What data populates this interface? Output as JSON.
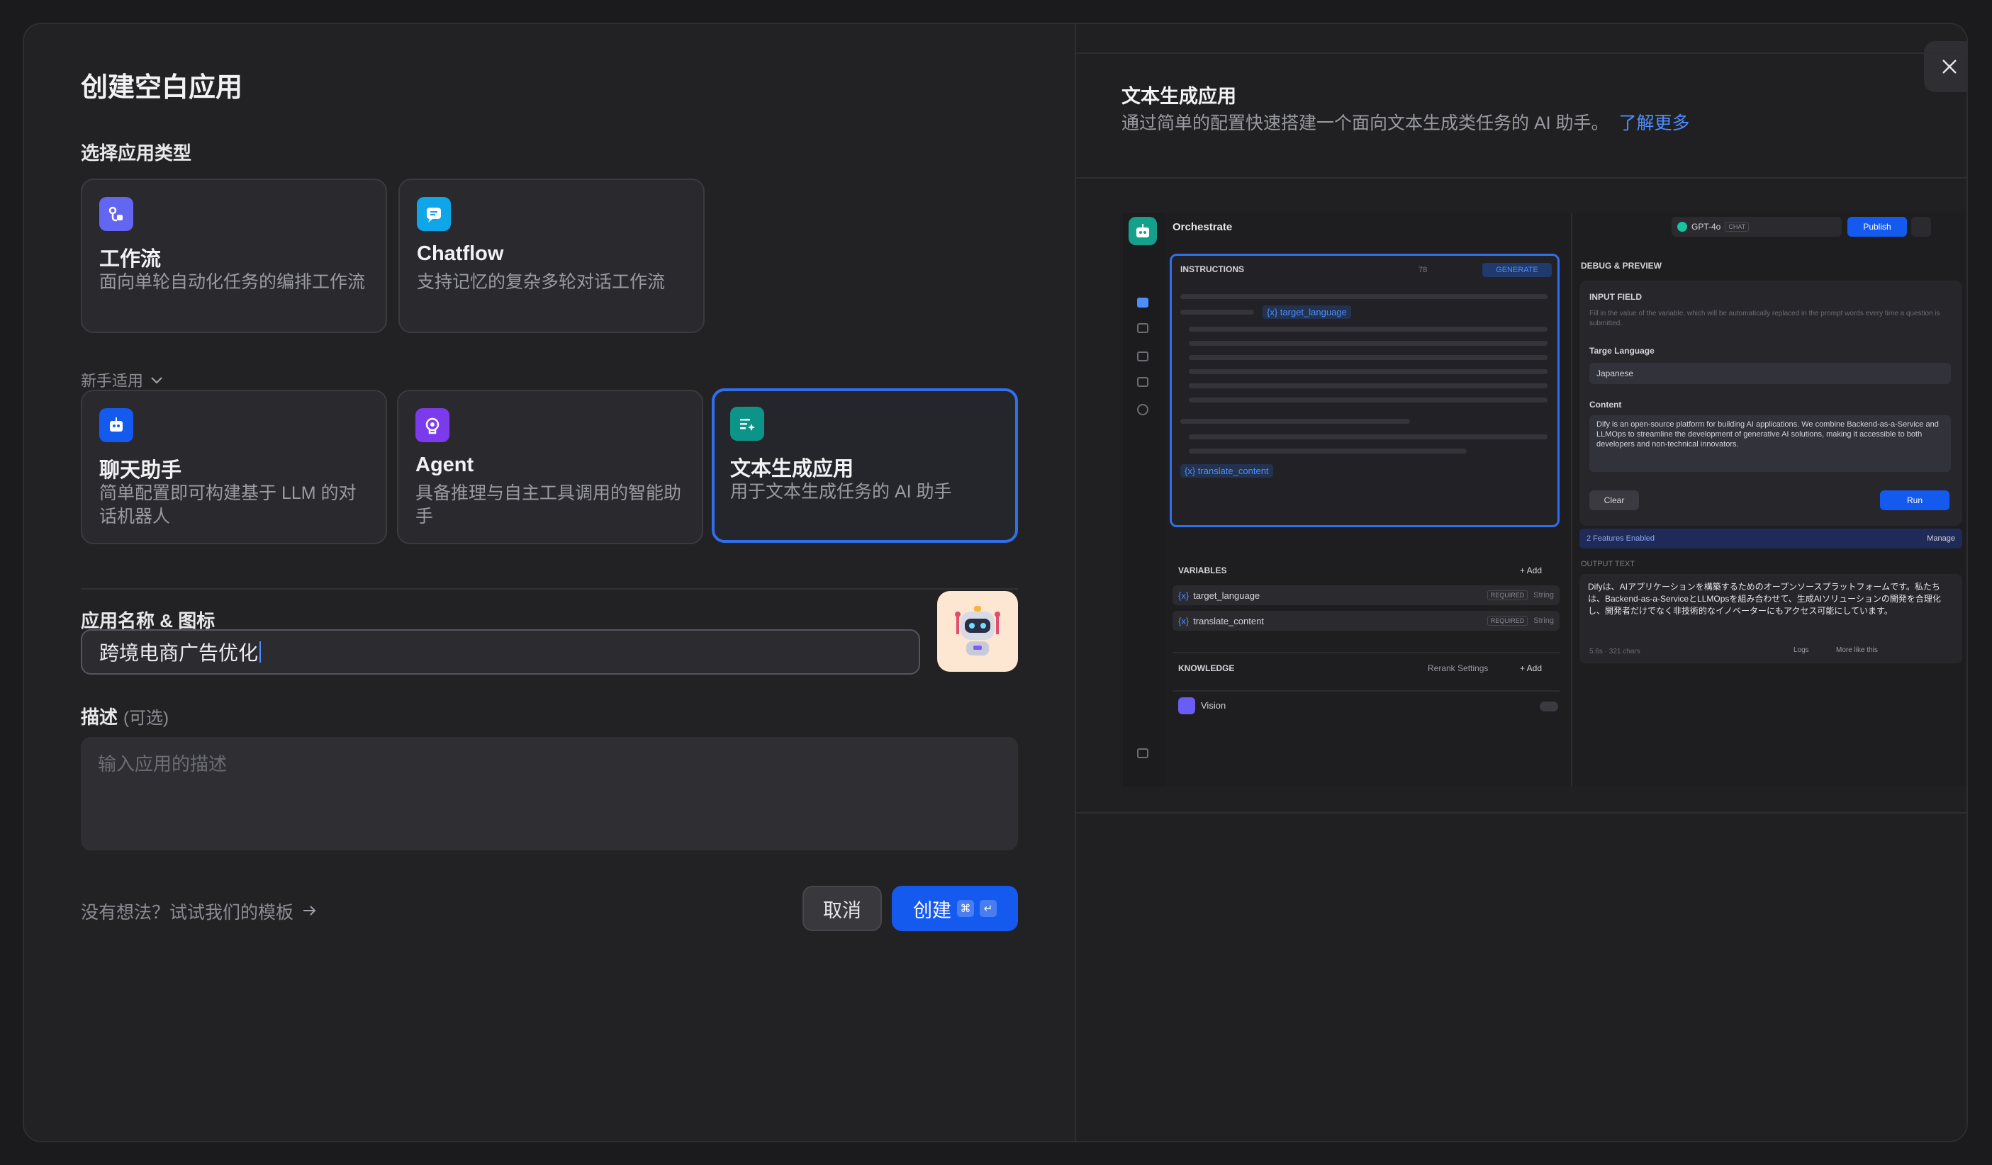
{
  "title": "创建空白应用",
  "section_app_type": "选择应用类型",
  "cards_top": [
    {
      "name": "工作流",
      "desc": "面向单轮自动化任务的编排工作流"
    },
    {
      "name": "Chatflow",
      "desc": "支持记忆的复杂多轮对话工作流"
    }
  ],
  "beginner_label": "新手适用",
  "cards_beginner": [
    {
      "name": "聊天助手",
      "desc": "简单配置即可构建基于 LLM 的对话机器人"
    },
    {
      "name": "Agent",
      "desc": "具备推理与自主工具调用的智能助手"
    },
    {
      "name": "文本生成应用",
      "desc": "用于文本生成任务的 AI 助手"
    }
  ],
  "name_section_label": "应用名称 & 图标",
  "name_value": "跨境电商广告优化",
  "desc_label": "描述",
  "desc_optional": "(可选)",
  "desc_placeholder": "输入应用的描述",
  "template_link": "没有想法？试试我们的模板",
  "cancel_label": "取消",
  "create_label": "创建",
  "colors": {
    "accent": "#155aef",
    "workflow": "#6366f1",
    "chatflow": "#0ea5e9",
    "chat": "#155aef",
    "agent": "#7c3aed",
    "textgen": "#0d9488"
  },
  "right": {
    "title": "文本生成应用",
    "desc": "通过简单的配置快速搭建一个面向文本生成类任务的 AI 助手。",
    "learn_more": "了解更多",
    "preview": {
      "app_title": "Orchestrate",
      "model": "GPT-4o",
      "model_badge": "CHAT",
      "publish": "Publish",
      "instructions": "INSTRUCTIONS",
      "instr_count": "78",
      "generate": "GENERATE",
      "var_tag1": "{x} target_language",
      "var_tag2": "{x} translate_content",
      "variables": "VARIABLES",
      "add": "+ Add",
      "vars": [
        {
          "name": "target_language",
          "req": "REQUIRED",
          "type": "String"
        },
        {
          "name": "translate_content",
          "req": "REQUIRED",
          "type": "String"
        }
      ],
      "knowledge": "KNOWLEDGE",
      "rerank": "Rerank Settings",
      "vision": "Vision",
      "debug": "DEBUG & PREVIEW",
      "input_field": "INPUT FIELD",
      "input_hint": "Fill in the value of the variable, which will be automatically replaced in the prompt words every time a question is submitted.",
      "target_label": "Targe Language",
      "target_value": "Japanese",
      "content_label": "Content",
      "content_value": "Dify is an open-source platform for building AI applications. We combine Backend-as-a-Service and LLMOps to streamline the development of generative AI solutions, making it accessible to both developers and non-technical innovators.",
      "clear": "Clear",
      "run": "Run",
      "features": "2 Features Enabled",
      "manage": "Manage",
      "output_label": "OUTPUT TEXT",
      "output_value": "Difyは、AIアプリケーションを構築するためのオープンソースプラットフォームです。私たちは、Backend-as-a-ServiceとLLMOpsを組み合わせて、生成AIソリューションの開発を合理化し、開発者だけでなく非技術的なイノベーターにもアクセス可能にしています。",
      "stats": "5.6s · 321 chars",
      "logs": "Logs",
      "more_like": "More like this"
    }
  }
}
